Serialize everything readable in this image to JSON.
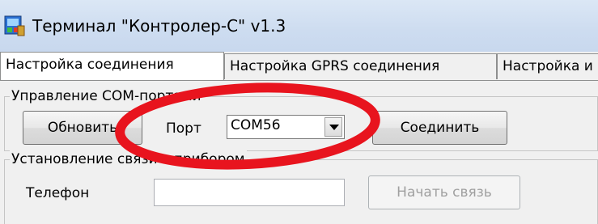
{
  "window": {
    "title": "Терминал \"Контролер-С\" v1.3",
    "icon": "terminal-app-icon"
  },
  "tabs": [
    {
      "label": "Настройка соединения",
      "active": true
    },
    {
      "label": "Настройка GPRS соединения",
      "active": false
    },
    {
      "label": "Настройка и",
      "active": false
    }
  ],
  "com_group": {
    "legend": "Управление СОМ-портами",
    "refresh_label": "Обновить",
    "port_label": "Порт",
    "port_value": "COM56",
    "connect_label": "Соединить"
  },
  "link_group": {
    "legend": "Установление связи с прибором",
    "phone_label": "Телефон",
    "phone_value": "",
    "start_label": "Начать связь"
  },
  "annotation": {
    "color": "#e8141e",
    "shape": "ellipse-highlight"
  },
  "colors": {
    "titlebar": "#cddcf0",
    "window_bg": "#f0f0f0"
  }
}
